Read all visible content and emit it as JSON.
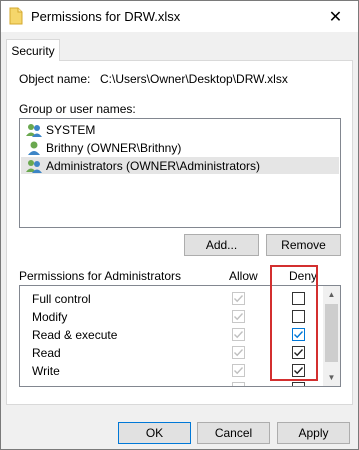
{
  "window": {
    "title": "Permissions for DRW.xlsx",
    "close_glyph": "✕"
  },
  "tab": {
    "label": "Security"
  },
  "object": {
    "label": "Object name:",
    "value": "C:\\Users\\Owner\\Desktop\\DRW.xlsx"
  },
  "group": {
    "label": "Group or user names:",
    "items": [
      {
        "label": "SYSTEM",
        "selected": false
      },
      {
        "label": "Brithny (OWNER\\Brithny)",
        "selected": false
      },
      {
        "label": "Administrators (OWNER\\Administrators)",
        "selected": true
      }
    ]
  },
  "buttons": {
    "add": "Add...",
    "remove": "Remove",
    "ok": "OK",
    "cancel": "Cancel",
    "apply": "Apply"
  },
  "permissions": {
    "label": "Permissions for Administrators",
    "allow_header": "Allow",
    "deny_header": "Deny",
    "rows": [
      {
        "name": "Full control",
        "allow": true,
        "deny": false
      },
      {
        "name": "Modify",
        "allow": true,
        "deny": false
      },
      {
        "name": "Read & execute",
        "allow": true,
        "deny": true
      },
      {
        "name": "Read",
        "allow": true,
        "deny": true
      },
      {
        "name": "Write",
        "allow": true,
        "deny": true
      }
    ]
  },
  "colors": {
    "highlight": "#d32f2f",
    "accent": "#0078d7"
  }
}
